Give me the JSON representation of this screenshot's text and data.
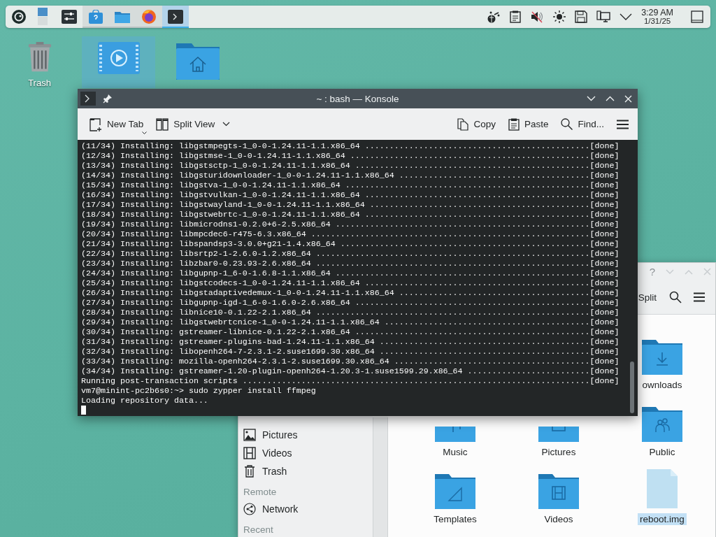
{
  "panel": {
    "launchers": [
      {
        "kind": "app-menu",
        "open": false,
        "active": false
      },
      {
        "kind": "pager",
        "open": false,
        "active": false
      },
      {
        "kind": "settings",
        "open": false,
        "active": false
      },
      {
        "kind": "discover",
        "open": true,
        "active": false
      },
      {
        "kind": "files",
        "open": true,
        "active": false
      },
      {
        "kind": "browser",
        "open": true,
        "active": false
      },
      {
        "kind": "terminal",
        "open": true,
        "active": true
      }
    ],
    "tray": [
      {
        "kind": "network"
      },
      {
        "kind": "clipboard"
      },
      {
        "kind": "volume-muted"
      },
      {
        "kind": "brightness"
      },
      {
        "kind": "disk"
      },
      {
        "kind": "display"
      },
      {
        "kind": "expand"
      }
    ],
    "clock": {
      "time": "3:29 AM",
      "date": "1/31/25"
    }
  },
  "desktop_icons": [
    {
      "kind": "trash",
      "label": "Trash",
      "selected": false
    },
    {
      "kind": "video",
      "selected": true
    },
    {
      "kind": "home",
      "selected": false
    }
  ],
  "file_manager": {
    "title_buttons": [
      {
        "kind": "help",
        "label": "?"
      },
      {
        "kind": "minimize"
      },
      {
        "kind": "maximize"
      },
      {
        "kind": "close"
      }
    ],
    "toolbar": [
      {
        "kind": "split",
        "label": "Split"
      },
      {
        "kind": "search"
      },
      {
        "kind": "menu"
      }
    ],
    "sidebar": [
      {
        "kind": "pictures",
        "label": "Pictures"
      },
      {
        "kind": "videos",
        "label": "Videos"
      },
      {
        "kind": "trash",
        "label": "Trash"
      },
      {
        "kind": "header",
        "label": "Remote"
      },
      {
        "kind": "network",
        "label": "Network"
      },
      {
        "kind": "header",
        "label": "Recent"
      }
    ],
    "rows": [
      [
        null,
        null,
        {
          "kind": "downloads",
          "label": "ownloads",
          "selected": false
        }
      ],
      [
        {
          "kind": "music",
          "label": "Music",
          "selected": false
        },
        {
          "kind": "pictures",
          "label": "Pictures",
          "selected": false
        },
        {
          "kind": "public",
          "label": "Public",
          "selected": false
        }
      ],
      [
        {
          "kind": "templates",
          "label": "Templates",
          "selected": false
        },
        {
          "kind": "videos",
          "label": "Videos",
          "selected": false
        },
        {
          "kind": "file",
          "label": "reboot.img",
          "selected": true
        }
      ]
    ]
  },
  "konsole": {
    "title": "~ : bash — Konsole",
    "toolbar_left": [
      {
        "kind": "new-tab",
        "label": "New Tab"
      },
      {
        "kind": "split-view",
        "label": "Split View"
      }
    ],
    "toolbar_right": [
      {
        "kind": "copy",
        "label": "Copy"
      },
      {
        "kind": "paste",
        "label": "Paste"
      },
      {
        "kind": "find",
        "label": "Find..."
      },
      {
        "kind": "menu"
      }
    ],
    "lines": [
      "(11/34) Installing: libgstmpegts-1_0-0-1.24.11-1.1.x86_64 ..............................................[done]",
      "(12/34) Installing: libgstmse-1_0-0-1.24.11-1.1.x86_64 .................................................[done]",
      "(13/34) Installing: libgstsctp-1_0-0-1.24.11-1.1.x86_64 ................................................[done]",
      "(14/34) Installing: libgsturidownloader-1_0-0-1.24.11-1.1.x86_64 .......................................[done]",
      "(15/34) Installing: libgstva-1_0-0-1.24.11-1.1.x86_64 ..................................................[done]",
      "(16/34) Installing: libgstvulkan-1_0-0-1.24.11-1.1.x86_64 ..............................................[done]",
      "(17/34) Installing: libgstwayland-1_0-0-1.24.11-1.1.x86_64 .............................................[done]",
      "(18/34) Installing: libgstwebrtc-1_0-0-1.24.11-1.1.x86_64 ..............................................[done]",
      "(19/34) Installing: libmicrodns1-0.2.0+6-2.5.x86_64 ....................................................[done]",
      "(20/34) Installing: libmpcdec6-r475-6.3.x86_64 .........................................................[done]",
      "(21/34) Installing: libspandsp3-3.0.0+g21-1.4.x86_64 ...................................................[done]",
      "(22/34) Installing: libsrtp2-1-2.6.0-1.2.x86_64 ........................................................[done]",
      "(23/34) Installing: libzbar0-0.23.93-2.6.x86_64 ........................................................[done]",
      "(24/34) Installing: libgupnp-1_6-0-1.6.8-1.1.x86_64 ....................................................[done]",
      "(25/34) Installing: libgstcodecs-1_0-0-1.24.11-1.1.x86_64 ..............................................[done]",
      "(26/34) Installing: libgstadaptivedemux-1_0-0-1.24.11-1.1.x86_64 .......................................[done]",
      "(27/34) Installing: libgupnp-igd-1_6-0-1.6.0-2.6.x86_64 ................................................[done]",
      "(28/34) Installing: libnice10-0.1.22-2.1.x86_64 ........................................................[done]",
      "(29/34) Installing: libgstwebrtcnice-1_0-0-1.24.11-1.1.x86_64 ..........................................[done]",
      "(30/34) Installing: gstreamer-libnice-0.1.22-2.1.x86_64 ................................................[done]",
      "(31/34) Installing: gstreamer-plugins-bad-1.24.11-1.1.x86_64 ...........................................[done]",
      "(32/34) Installing: libopenh264-7-2.3.1-2.suse1699.30.x86_64 ...........................................[done]",
      "(33/34) Installing: mozilla-openh264-2.3.1-2.suse1699.30.x86_64 ........................................[done]",
      "(34/34) Installing: gstreamer-1.20-plugin-openh264-1.20.3-1.suse1599.29.x86_64 .........................[done]",
      "Running post-transaction scripts .......................................................................[done]",
      "vm7@minint-pc2b6s0:~> sudo zypper install ffmpeg",
      "Loading repository data..."
    ],
    "cursor": true
  }
}
